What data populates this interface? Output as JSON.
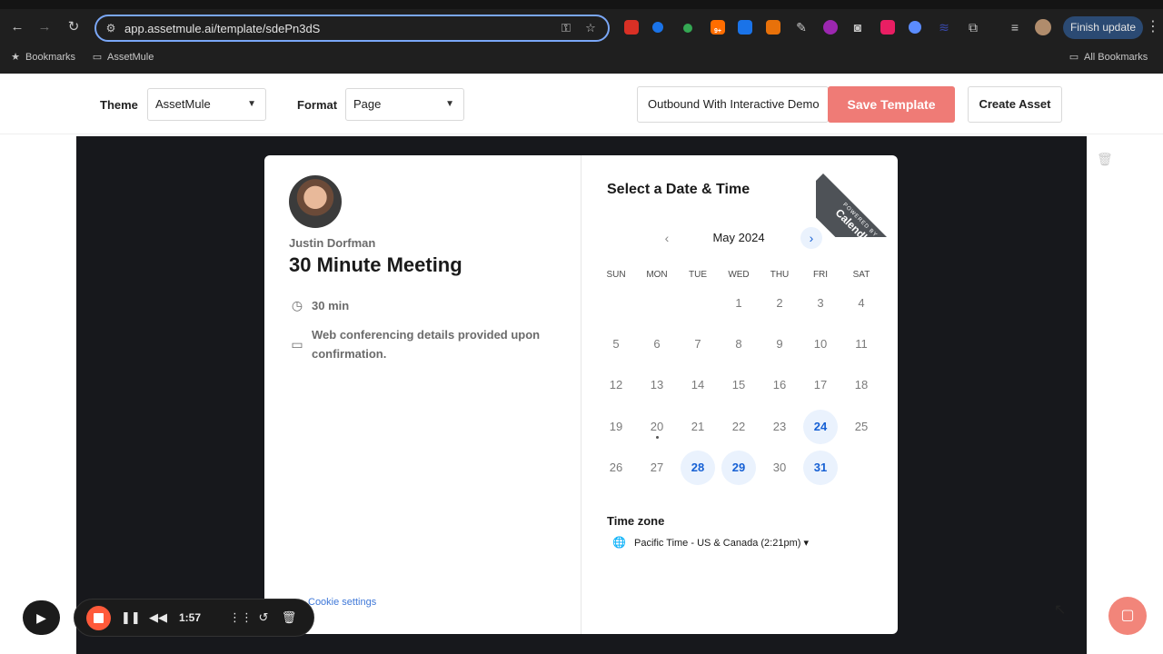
{
  "browser": {
    "url": "app.assetmule.ai/template/sdePn3dS",
    "finish_update": "Finish update",
    "ext_badge": "9+",
    "bookmarks": [
      {
        "label": "Bookmarks",
        "icon": "star-icon"
      },
      {
        "label": "AssetMule",
        "icon": "folder-icon"
      }
    ],
    "all_bookmarks": "All Bookmarks"
  },
  "toolbar": {
    "theme_label": "Theme",
    "theme_value": "AssetMule",
    "format_label": "Format",
    "format_value": "Page",
    "template_name": "Outbound With Interactive Demo",
    "save_label": "Save Template",
    "create_label": "Create Asset"
  },
  "event": {
    "host": "Justin Dorfman",
    "title": "30 Minute Meeting",
    "duration": "30 min",
    "conferencing": "Web conferencing details provided upon confirmation.",
    "cookie_link": "Cookie settings"
  },
  "calendar": {
    "heading": "Select a Date & Time",
    "ribbon_small": "POWERED BY",
    "ribbon_brand": "Calendly",
    "month": "May 2024",
    "weekdays": [
      "SUN",
      "MON",
      "TUE",
      "WED",
      "THU",
      "FRI",
      "SAT"
    ],
    "days": [
      "",
      "",
      "",
      "1",
      "2",
      "3",
      "4",
      "5",
      "6",
      "7",
      "8",
      "9",
      "10",
      "11",
      "12",
      "13",
      "14",
      "15",
      "16",
      "17",
      "18",
      "19",
      "20",
      "21",
      "22",
      "23",
      "24",
      "25",
      "26",
      "27",
      "28",
      "29",
      "30",
      "31",
      ""
    ],
    "available_days": [
      "24",
      "28",
      "29",
      "31"
    ],
    "today": "20",
    "timezone_label": "Time zone",
    "timezone_value": "Pacific Time - US & Canada (2:21pm)"
  },
  "recorder": {
    "elapsed": "1:57"
  },
  "colors": {
    "accent_blue": "#1660d4",
    "available_bg": "#eaf2fd",
    "save_button": "#ef7b76",
    "record_stop": "#ff5a3a"
  }
}
